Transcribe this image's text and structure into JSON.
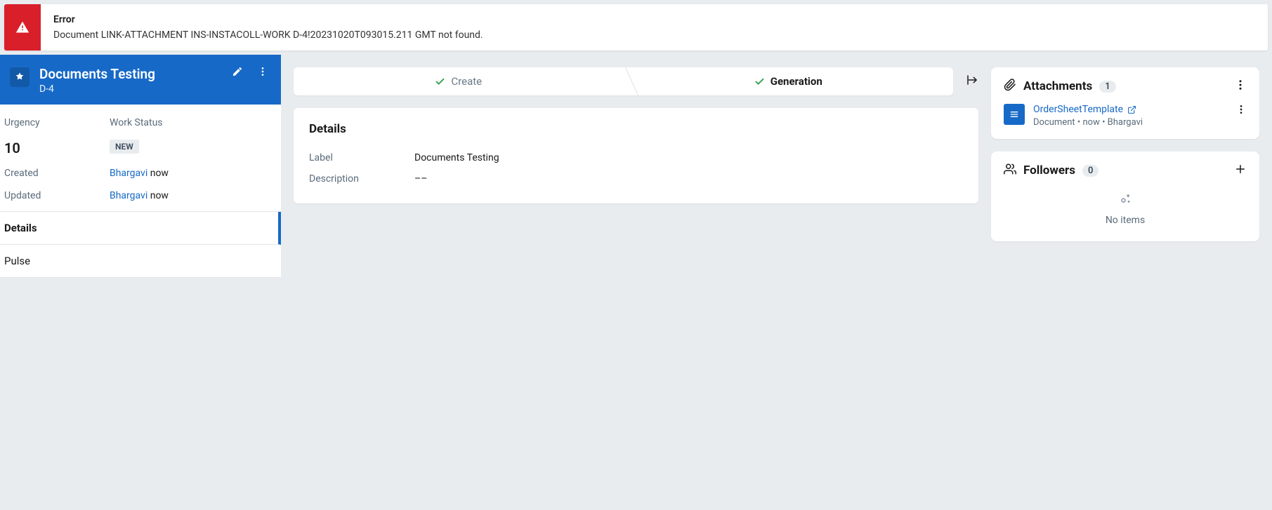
{
  "error": {
    "title": "Error",
    "message": "Document LINK-ATTACHMENT INS-INSTACOLL-WORK D-4!20231020T093015.211 GMT not found."
  },
  "case": {
    "title": "Documents Testing",
    "id": "D-4"
  },
  "sidebar": {
    "urgency_label": "Urgency",
    "urgency_value": "10",
    "work_status_label": "Work Status",
    "work_status_value": "NEW",
    "created_label": "Created",
    "created_user": "Bhargavi",
    "created_time": "now",
    "updated_label": "Updated",
    "updated_user": "Bhargavi",
    "updated_time": "now",
    "tabs": {
      "details": "Details",
      "pulse": "Pulse"
    }
  },
  "stepper": {
    "create": "Create",
    "generation": "Generation"
  },
  "details": {
    "heading": "Details",
    "label_k": "Label",
    "label_v": "Documents Testing",
    "description_k": "Description",
    "description_v": "––"
  },
  "attachments": {
    "heading": "Attachments",
    "count": "1",
    "item": {
      "name": "OrderSheetTemplate",
      "subtitle": "Document • now • Bhargavi"
    }
  },
  "followers": {
    "heading": "Followers",
    "count": "0",
    "empty_text": "No items"
  }
}
